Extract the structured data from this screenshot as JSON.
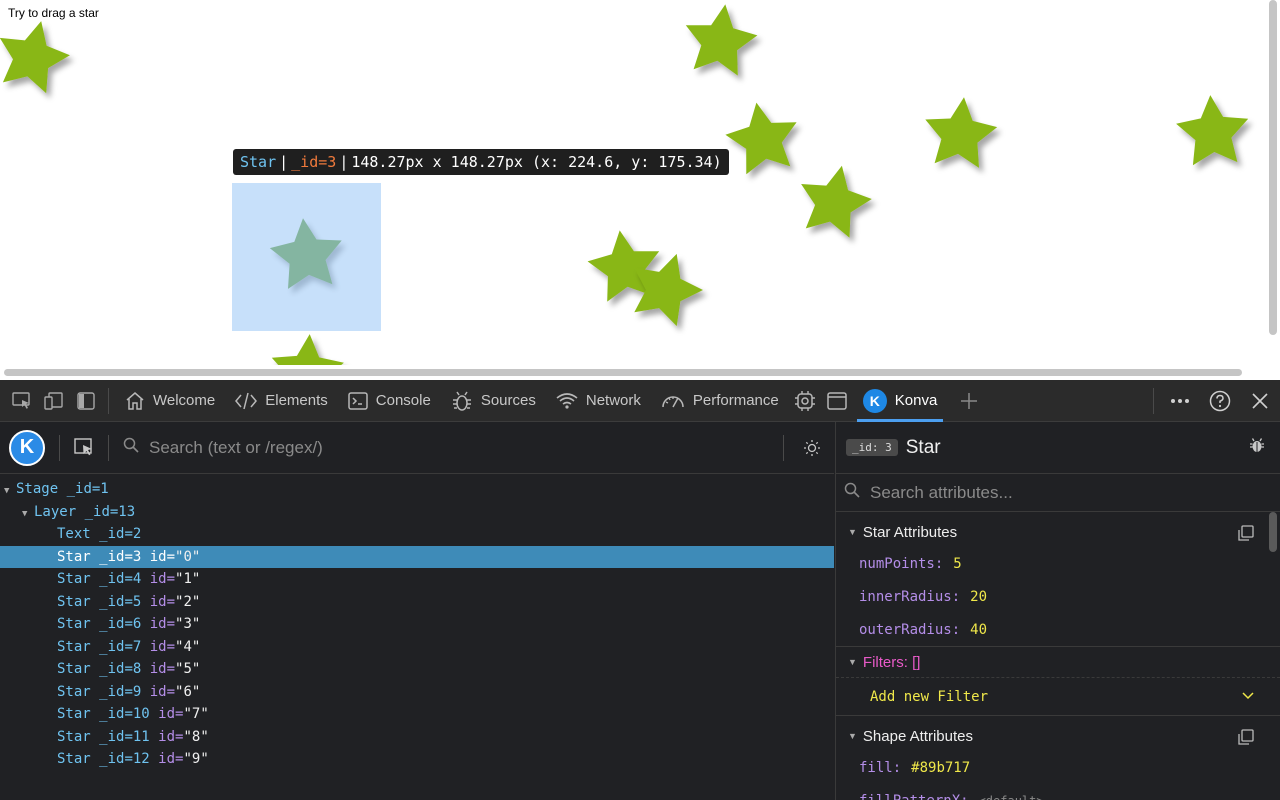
{
  "page": {
    "hint_text": "Try to drag a star",
    "star_color": "#89b717",
    "tooltip": {
      "name": "Star",
      "id": "_id=3",
      "size": "148.27px x 148.27px (x: 224.6, y: 175.34)"
    }
  },
  "devtools": {
    "tabs": [
      {
        "label": "Welcome",
        "icon": "home-icon"
      },
      {
        "label": "Elements",
        "icon": "code-icon"
      },
      {
        "label": "Console",
        "icon": "console-icon"
      },
      {
        "label": "Sources",
        "icon": "bug-icon"
      },
      {
        "label": "Network",
        "icon": "wifi-icon"
      },
      {
        "label": "Performance",
        "icon": "gauge-icon"
      },
      {
        "label": "Konva",
        "icon": "konva-icon",
        "active": true
      }
    ],
    "konva_letter": "K",
    "search_placeholder": "Search (text or /regex/)",
    "tree": [
      {
        "name": "Stage",
        "id": "_id=1",
        "attr": "",
        "depth": 0,
        "arrow": true
      },
      {
        "name": "Layer",
        "id": "_id=13",
        "attr": "",
        "depth": 1,
        "arrow": true
      },
      {
        "name": "Text",
        "id": "_id=2",
        "attr": "",
        "depth": 2
      },
      {
        "name": "Star",
        "id": "_id=3",
        "attr": "\"0\"",
        "depth": 2,
        "selected": true
      },
      {
        "name": "Star",
        "id": "_id=4",
        "attr": "\"1\"",
        "depth": 2
      },
      {
        "name": "Star",
        "id": "_id=5",
        "attr": "\"2\"",
        "depth": 2
      },
      {
        "name": "Star",
        "id": "_id=6",
        "attr": "\"3\"",
        "depth": 2
      },
      {
        "name": "Star",
        "id": "_id=7",
        "attr": "\"4\"",
        "depth": 2
      },
      {
        "name": "Star",
        "id": "_id=8",
        "attr": "\"5\"",
        "depth": 2
      },
      {
        "name": "Star",
        "id": "_id=9",
        "attr": "\"6\"",
        "depth": 2
      },
      {
        "name": "Star",
        "id": "_id=10",
        "attr": "\"7\"",
        "depth": 2
      },
      {
        "name": "Star",
        "id": "_id=11",
        "attr": "\"8\"",
        "depth": 2
      },
      {
        "name": "Star",
        "id": "_id=12",
        "attr": "\"9\"",
        "depth": 2
      }
    ],
    "id_label": "id=",
    "inspector": {
      "id_chip": "_id: 3",
      "title": "Star",
      "search_placeholder": "Search attributes...",
      "star_section": "Star Attributes",
      "star_attrs": [
        {
          "key": "numPoints:",
          "value": "5"
        },
        {
          "key": "innerRadius:",
          "value": "20"
        },
        {
          "key": "outerRadius:",
          "value": "40"
        }
      ],
      "filters_section": "Filters: []",
      "add_filter": "Add new Filter",
      "shape_section": "Shape Attributes",
      "shape_attrs": [
        {
          "key": "fill:",
          "value": "#89b717",
          "default": false
        },
        {
          "key": "fillPatternX:",
          "value": "<default>",
          "default": true
        }
      ]
    }
  }
}
